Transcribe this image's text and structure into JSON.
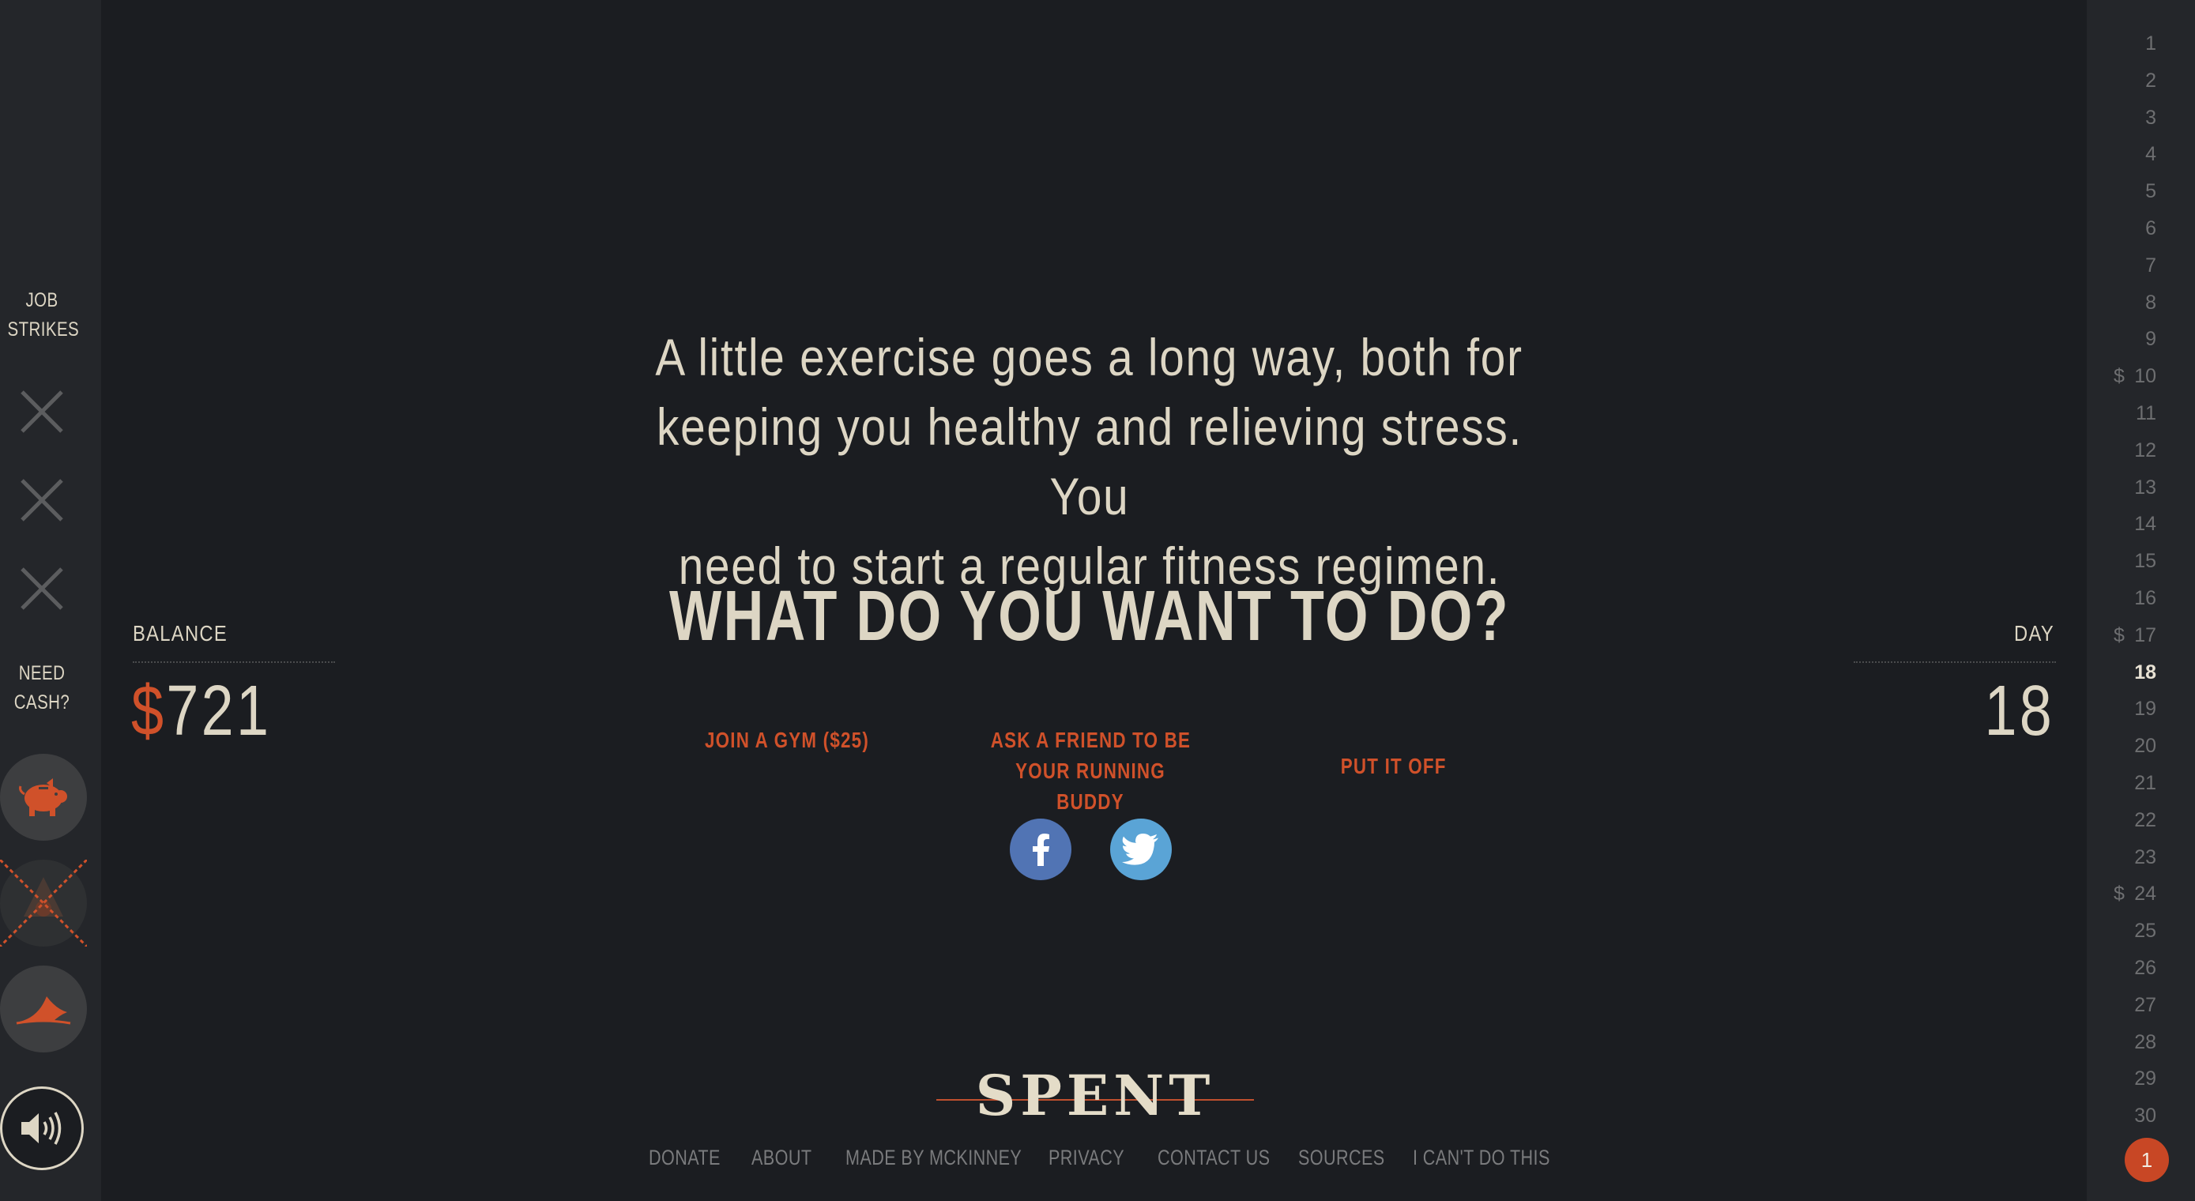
{
  "sidebar": {
    "job_strikes_label_1": "JOB",
    "job_strikes_label_2": "STRIKES",
    "need_cash_label_1": "NEED",
    "need_cash_label_2": "CASH?",
    "strikes_count": 3,
    "cash_options": [
      "piggy-bank-icon",
      "pawn-icon",
      "shark-fin-icon"
    ],
    "sound_icon": "speaker-icon"
  },
  "balance": {
    "label": "BALANCE",
    "currency": "$",
    "amount": "721"
  },
  "day": {
    "label": "DAY",
    "value": "18"
  },
  "scenario": {
    "line1": "A little exercise goes a long way, both for",
    "line2": "keeping you healthy and relieving stress. You",
    "line3": "need to start a regular fitness regimen.",
    "question": "WHAT DO YOU WANT TO DO?"
  },
  "choices": {
    "option1": "JOIN A GYM ($25)",
    "option2_line1": "ASK A FRIEND TO BE",
    "option2_line2": "YOUR RUNNING BUDDY",
    "option3": "PUT IT OFF"
  },
  "social": {
    "facebook_color": "#5174b4",
    "twitter_color": "#5aa4d6"
  },
  "logo": "SPENT",
  "footer": {
    "donate": "DONATE",
    "about": "ABOUT",
    "made_by": "MADE BY MCKINNEY",
    "privacy": "PRIVACY",
    "contact": "CONTACT US",
    "sources": "SOURCES",
    "cant_do": "I CAN'T DO THIS"
  },
  "calendar": {
    "days": [
      "1",
      "2",
      "3",
      "4",
      "5",
      "6",
      "7",
      "8",
      "9",
      "10",
      "11",
      "12",
      "13",
      "14",
      "15",
      "16",
      "17",
      "18",
      "19",
      "20",
      "21",
      "22",
      "23",
      "24",
      "25",
      "26",
      "27",
      "28",
      "29",
      "30"
    ],
    "current_day": "18",
    "payday_symbol": "$",
    "paydays": [
      "10",
      "17",
      "24"
    ],
    "month_badge": "1"
  },
  "colors": {
    "background": "#1b1d21",
    "accent": "#d0512a",
    "text": "#ddd6c4"
  }
}
